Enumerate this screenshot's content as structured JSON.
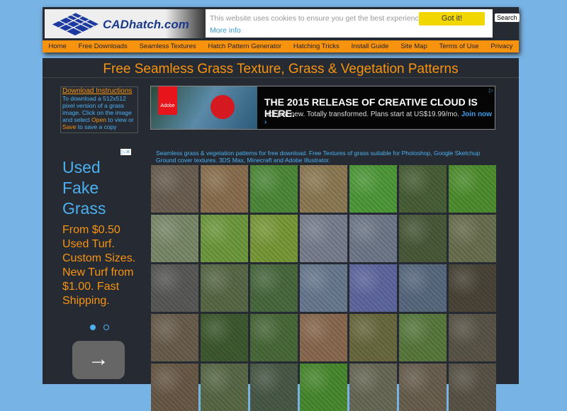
{
  "header": {
    "brand": "CADhatch.com",
    "search_label": "Search"
  },
  "cookie": {
    "text": "This website uses cookies to ensure you get the best experience on our website",
    "link": "More info",
    "button": "Got it!"
  },
  "nav": [
    "Home",
    "Free Downloads",
    "Seamless Textures",
    "Hatch Pattern Generator",
    "Hatching Tricks",
    "Install Guide",
    "Site Map",
    "Terms of Use",
    "Privacy"
  ],
  "page": {
    "title": "Free Seamless Grass Texture, Grass & Vegetation Patterns",
    "description": "Seamless grass & vegetation patterns for free download. Free Textures of grass suitable for Photoshop, Google Sketchup Ground cover textures. 3DS Max, Minecraft and Adobe Illustrator."
  },
  "instructions": {
    "title": "Download Instructions",
    "text1": "To download a 512x512 pixel version of a grass image. Click on the image and select ",
    "open": "Open",
    "text2": " to view or ",
    "save": "Save",
    "text3": " to save a copy"
  },
  "banner_ad": {
    "logo": "Adobe",
    "headline": "THE 2015 RELEASE OF CREATIVE CLOUD IS HERE.",
    "sub": "Not just new. Totally transformed. Plans start at US$19.99/mo.",
    "cta": "Join now ›"
  },
  "side_ad": {
    "title": "Used Fake Grass",
    "body": "From $0.50 Used Turf. Custom Sizes. New Turf from $1.00. Fast Shipping.",
    "next": "→"
  },
  "tiles": [
    "#6b6052",
    "#8a7050",
    "#4f8a3a",
    "#8d7b55",
    "#4f9a3a",
    "#4a6038",
    "#4f8f30",
    "#7b8a6a",
    "#6f9a3f",
    "#7a9a3a",
    "#7a8090",
    "#707a8a",
    "#4a5a3a",
    "#6a7050",
    "#5a5a58",
    "#5a6a48",
    "#4a6a40",
    "#6a7a90",
    "#6068a0",
    "#5a6a80",
    "#4a4538",
    "#6a5e4e",
    "#3f5a30",
    "#4a6a3a",
    "#8a6a50",
    "#6a6a40",
    "#5a7a40",
    "#5a5548",
    "#6a5a48",
    "#5a6a48",
    "#4a5a48",
    "#4a8a30",
    "#6a6a58",
    "#6a6050",
    "#5a5448"
  ]
}
